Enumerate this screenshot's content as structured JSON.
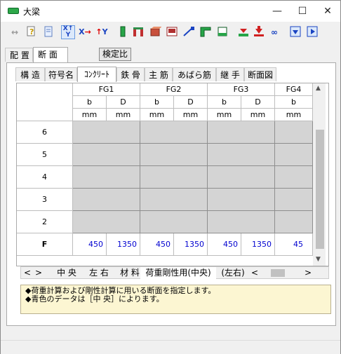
{
  "window": {
    "title": "大梁",
    "minimize": "—",
    "maximize": "☐",
    "close": "✕"
  },
  "toolbar": {
    "icons": [
      "link-icon",
      "help-icon",
      "document-icon",
      "swap-xy-icon",
      "x-arrow-icon",
      "y-arrow-icon",
      "column-icon",
      "frame-icon",
      "box-icon",
      "panel-icon",
      "beam-icon",
      "corner-icon",
      "wall-icon",
      "load-arrow-icon",
      "arrow-down-icon",
      "chain-icon",
      "import-icon",
      "export-icon"
    ]
  },
  "tabs_main": [
    {
      "label": "配 置"
    },
    {
      "label": "断 面"
    }
  ],
  "kentei_button": "検定比",
  "tabs_sub": [
    {
      "label": "構 造"
    },
    {
      "label": "符号名"
    },
    {
      "label": "ｺﾝｸﾘｰﾄ"
    },
    {
      "label": "鉄 骨"
    },
    {
      "label": "主 筋"
    },
    {
      "label": "あばら筋"
    },
    {
      "label": "継 手"
    },
    {
      "label": "断面図"
    }
  ],
  "grid": {
    "groups": [
      "FG1",
      "FG2",
      "FG3",
      "FG4"
    ],
    "sub_headers": [
      "b",
      "D",
      "b",
      "D",
      "b",
      "D",
      "b"
    ],
    "units": [
      "mm",
      "mm",
      "mm",
      "mm",
      "mm",
      "mm",
      "mm"
    ],
    "row_labels": [
      "6",
      "5",
      "4",
      "3",
      "2",
      "F"
    ],
    "values": {
      "F": [
        "450",
        "1350",
        "450",
        "1350",
        "450",
        "1350",
        "45"
      ]
    }
  },
  "scroll_arrows": {
    "up": "▲",
    "down": "▼",
    "left": "<",
    "right": ">"
  },
  "sheets": [
    "中 央",
    "左 右",
    "材 料",
    "荷重剛性用(中央)",
    "(左右)"
  ],
  "messages": [
    "◆荷重計算および剛性計算に用いる断面を指定します。",
    "◆青色のデータは［中 央］によります。"
  ]
}
